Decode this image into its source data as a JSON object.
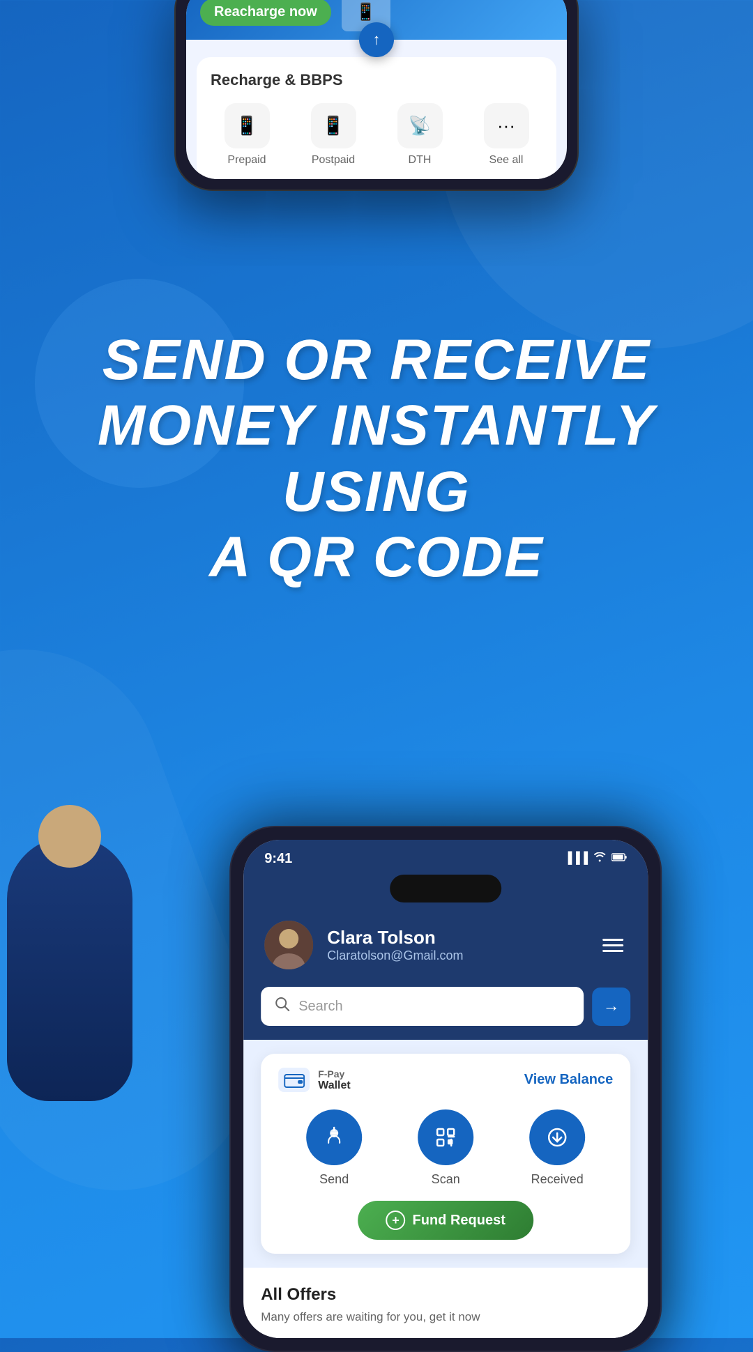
{
  "top_section": {
    "banner": {
      "recharge_button": "Reacharge now"
    },
    "arrow_icon": "↑",
    "recharge_card": {
      "title": "Recharge & BBPS",
      "icons": [
        {
          "icon": "📱",
          "label": "Prepaid"
        },
        {
          "icon": "📱",
          "label": "Postpaid"
        },
        {
          "icon": "📡",
          "label": "DTH"
        },
        {
          "icon": "···",
          "label": "See all"
        }
      ]
    }
  },
  "headline": {
    "line1": "SEND OR RECEIVE",
    "line2": "MONEY INSTANTLY USING",
    "line3": "A QR CODE"
  },
  "phone": {
    "status_bar": {
      "time": "9:41",
      "signal": "▐▐▐",
      "wifi": "wifi",
      "battery": "battery"
    },
    "header": {
      "user_name": "Clara Tolson",
      "user_email": "Claratolson@Gmail.com",
      "menu_icon": "☰"
    },
    "search": {
      "placeholder": "Search",
      "arrow": "→"
    },
    "wallet": {
      "fpay_label": "F-Pay",
      "wallet_label": "Wallet",
      "view_balance": "View Balance"
    },
    "actions": [
      {
        "label": "Send",
        "icon": "↑"
      },
      {
        "label": "Scan",
        "icon": "⊡"
      },
      {
        "label": "Received",
        "icon": "↺"
      }
    ],
    "fund_request": {
      "label": "Fund Request",
      "plus": "+"
    },
    "offers": {
      "title": "All Offers",
      "subtitle": "Many offers are waiting for you, get it now"
    }
  }
}
